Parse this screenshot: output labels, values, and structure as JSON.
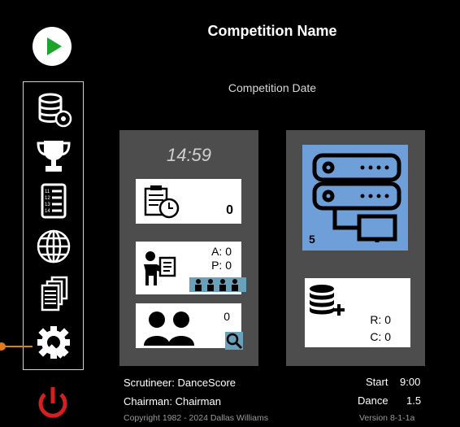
{
  "header": {
    "title": "Competition Name",
    "date": "Competition Date"
  },
  "sidebar": {
    "items": [
      {
        "icon": "database-settings-icon"
      },
      {
        "icon": "trophy-icon"
      },
      {
        "icon": "numbered-list-icon"
      },
      {
        "icon": "globe-icon"
      },
      {
        "icon": "documents-icon"
      },
      {
        "icon": "settings-wrench-icon",
        "selected": true
      }
    ]
  },
  "left_panel": {
    "clock": "14:59",
    "schedule_count": "0",
    "adjudicators": {
      "a_label": "A: 0",
      "p_label": "P: 0"
    },
    "couples_count": "0"
  },
  "right_panel": {
    "server_count": "5",
    "database": {
      "r_label": "R: 0",
      "c_label": "C: 0"
    }
  },
  "footer": {
    "scrutineer": "Scrutineer: DanceScore",
    "chairman": "Chairman: Chairman",
    "copyright": "Copyright 1982 - 2024 Dallas Williams",
    "start_label": "Start",
    "start_value": "9:00",
    "dance_label": "Dance",
    "dance_value": "1.5",
    "version": "Version 8-1-1a"
  },
  "colors": {
    "accent_green": "#1fa32a",
    "power_red": "#d42020",
    "server_blue": "#6f9fd8",
    "panel_gray": "#4d4d4d",
    "selection_orange": "#e07b1f"
  }
}
